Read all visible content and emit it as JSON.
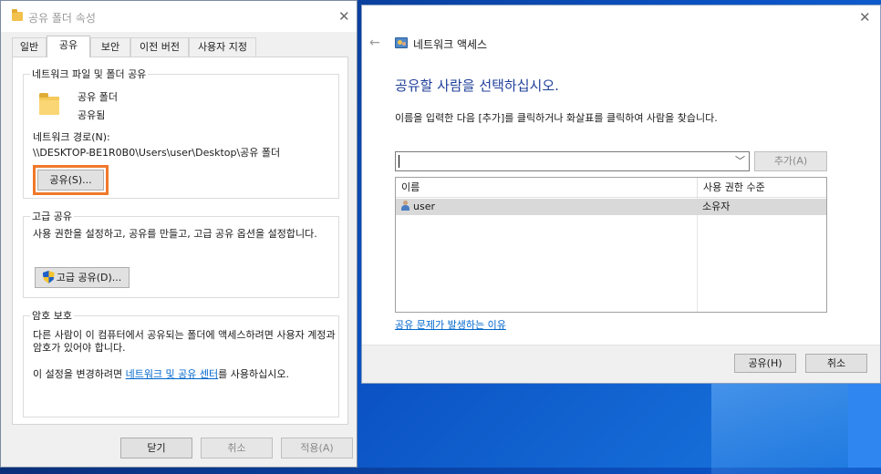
{
  "props_dialog": {
    "title": "공유 폴더 속성",
    "close_glyph": "✕",
    "tabs": [
      "일반",
      "공유",
      "보안",
      "이전 버전",
      "사용자 지정"
    ],
    "active_tab": "공유",
    "network_group": {
      "legend": "네트워크 파일 및 폴더 공유",
      "folder_name": "공유 폴더",
      "share_state": "공유됨",
      "path_label": "네트워크 경로(N):",
      "path_value": "\\\\DESKTOP-BE1R0B0\\Users\\user\\Desktop\\공유 폴더",
      "share_button": "공유(S)..."
    },
    "advanced_group": {
      "legend": "고급 공유",
      "description": "사용 권한을 설정하고, 공유를 만들고, 고급 공유 옵션을 설정합니다.",
      "button": "고급 공유(D)..."
    },
    "password_group": {
      "legend": "암호 보호",
      "description": "다른 사람이 이 컴퓨터에서 공유되는 폴더에 액세스하려면 사용자 계정과 암호가 있어야 합니다.",
      "change_prefix": "이 설정을 변경하려면 ",
      "change_link": "네트워크 및 공유 센터",
      "change_suffix": "를 사용하십시오."
    },
    "footer": {
      "close": "닫기",
      "cancel": "취소",
      "apply": "적용(A)"
    }
  },
  "network_access_dialog": {
    "title": "네트워크 액세스",
    "back_glyph": "←",
    "close_glyph": "✕",
    "heading": "공유할 사람을 선택하십시오.",
    "instruction": "이름을 입력한 다음 [추가]를 클릭하거나 화살표를 클릭하여 사람을 찾습니다.",
    "input_value": "",
    "add_button": "추가(A)",
    "table": {
      "columns": [
        "이름",
        "사용 권한 수준"
      ],
      "rows": [
        {
          "name": "user",
          "level": "소유자"
        }
      ]
    },
    "help_link": "공유 문제가 발생하는 이유",
    "share_button": "공유(H)",
    "cancel_button": "취소"
  },
  "colors": {
    "heading_blue": "#1f3f9a",
    "link_blue": "#0066cc",
    "highlight_orange": "#f0782a"
  }
}
